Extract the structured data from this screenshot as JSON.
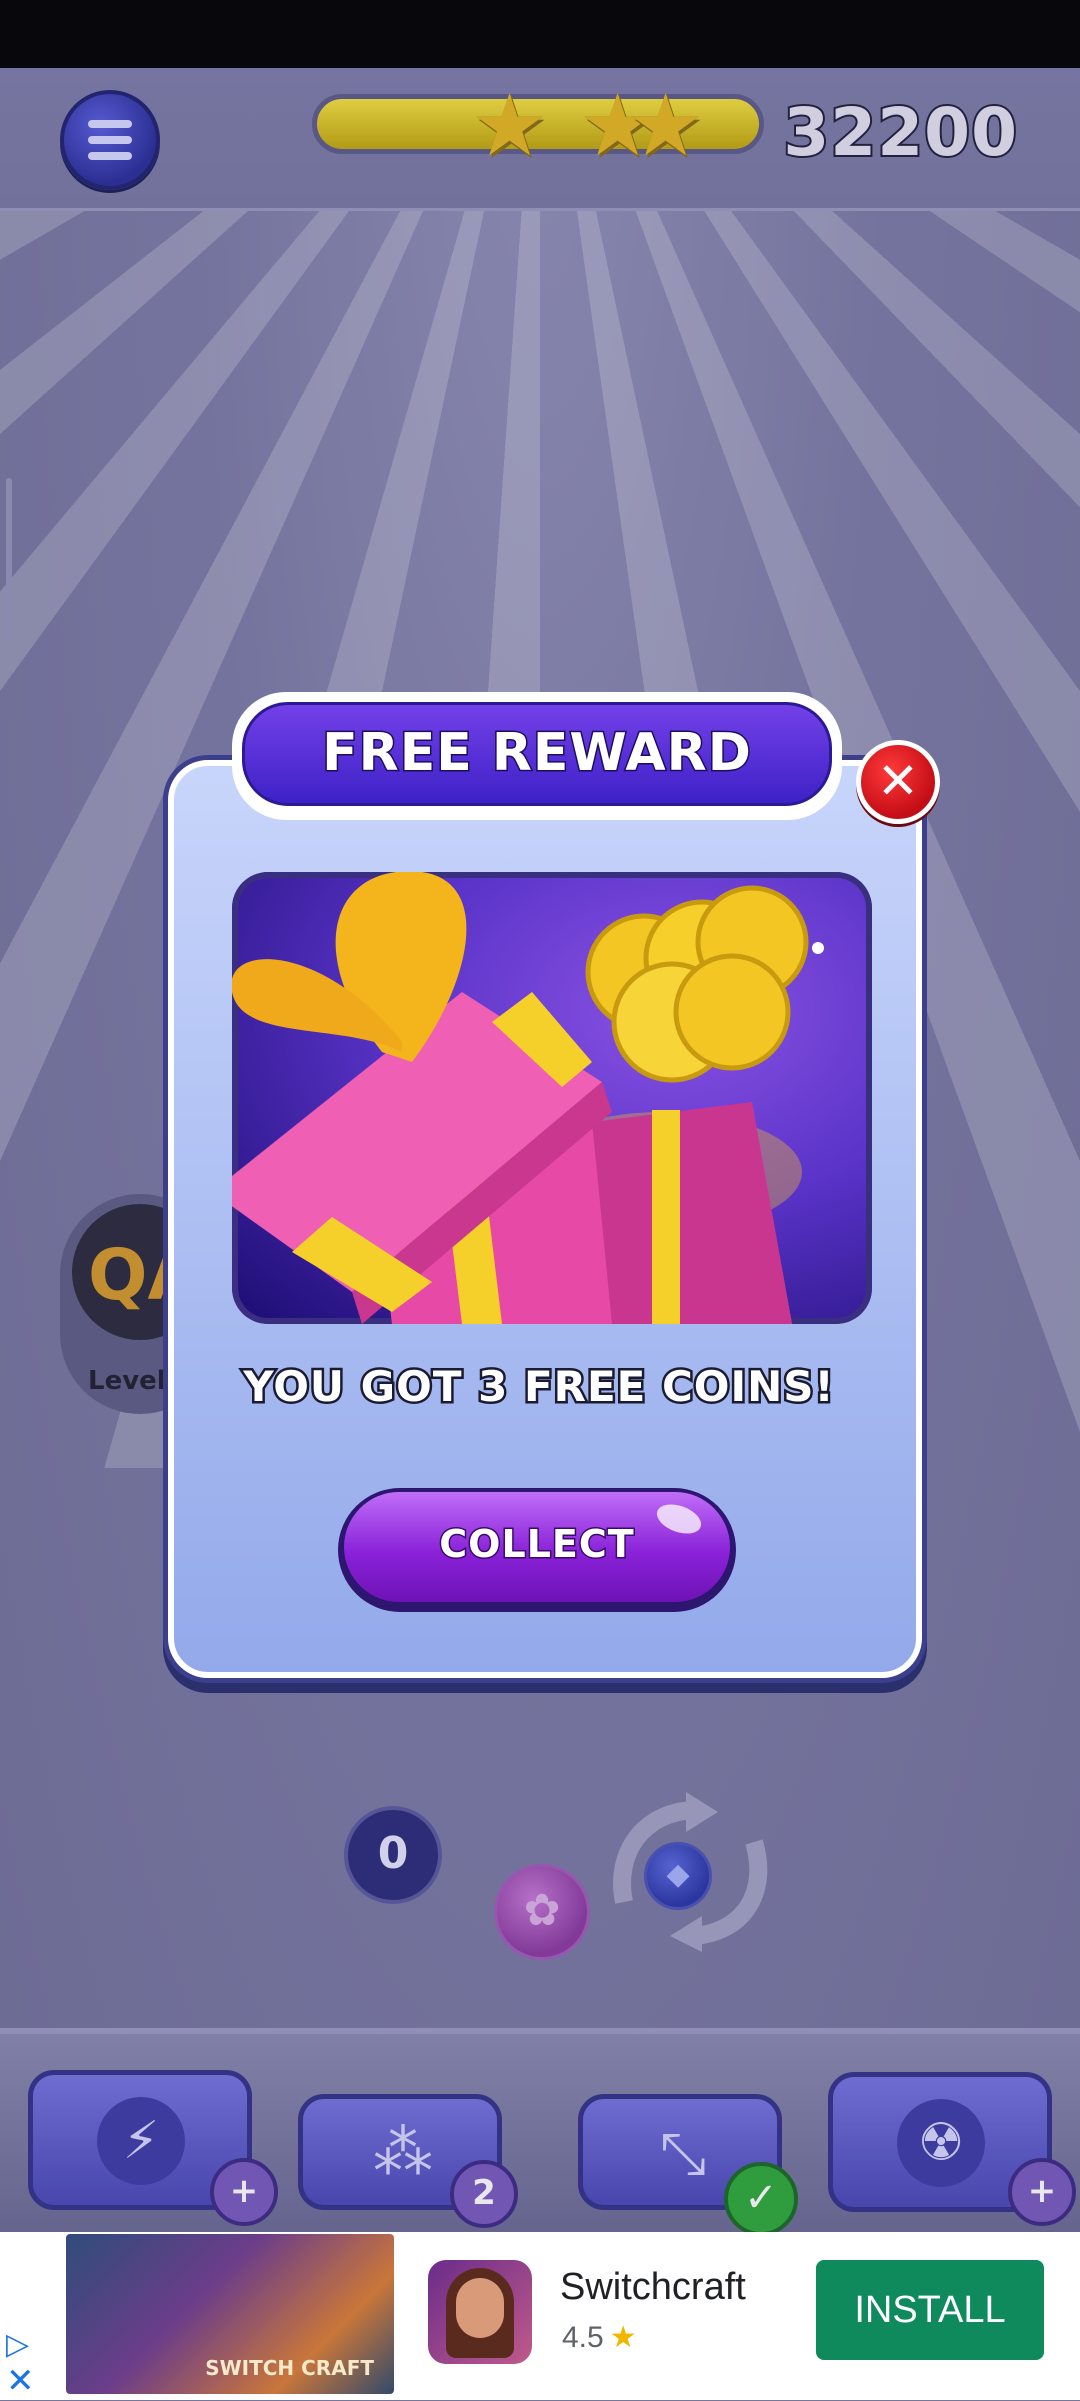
{
  "header": {
    "menu_icon": "hamburger-menu-icon",
    "score": "32200",
    "stars_earned": 3,
    "progress_fill": 1.0
  },
  "background": {
    "level_badge_text": "QA",
    "level_label": "Level"
  },
  "popup": {
    "title": "FREE REWARD",
    "close_icon": "close-icon",
    "message": "YOU GOT 3 FREE COINS!",
    "collect_label": "COLLECT",
    "illustration": "gift-box-with-coins"
  },
  "play_area": {
    "counter_value": "0",
    "current_ball_icon": "flower-ball-icon",
    "next_ball_icon": "diamond-ball-icon",
    "swap_icon": "swap-arrows-icon"
  },
  "boosters": [
    {
      "icon": "lightning-icon",
      "badge": "+"
    },
    {
      "icon": "split-icon",
      "badge": "2"
    },
    {
      "icon": "aim-line-icon",
      "badge": "✓"
    },
    {
      "icon": "radiation-icon",
      "badge": "+"
    }
  ],
  "ad": {
    "app_name": "Switchcraft",
    "rating": "4.5",
    "install_label": "INSTALL",
    "thumbnail_text": "SWITCH CRAFT",
    "colors": {
      "install": "#0f8a5c",
      "star": "#f2b600"
    }
  }
}
